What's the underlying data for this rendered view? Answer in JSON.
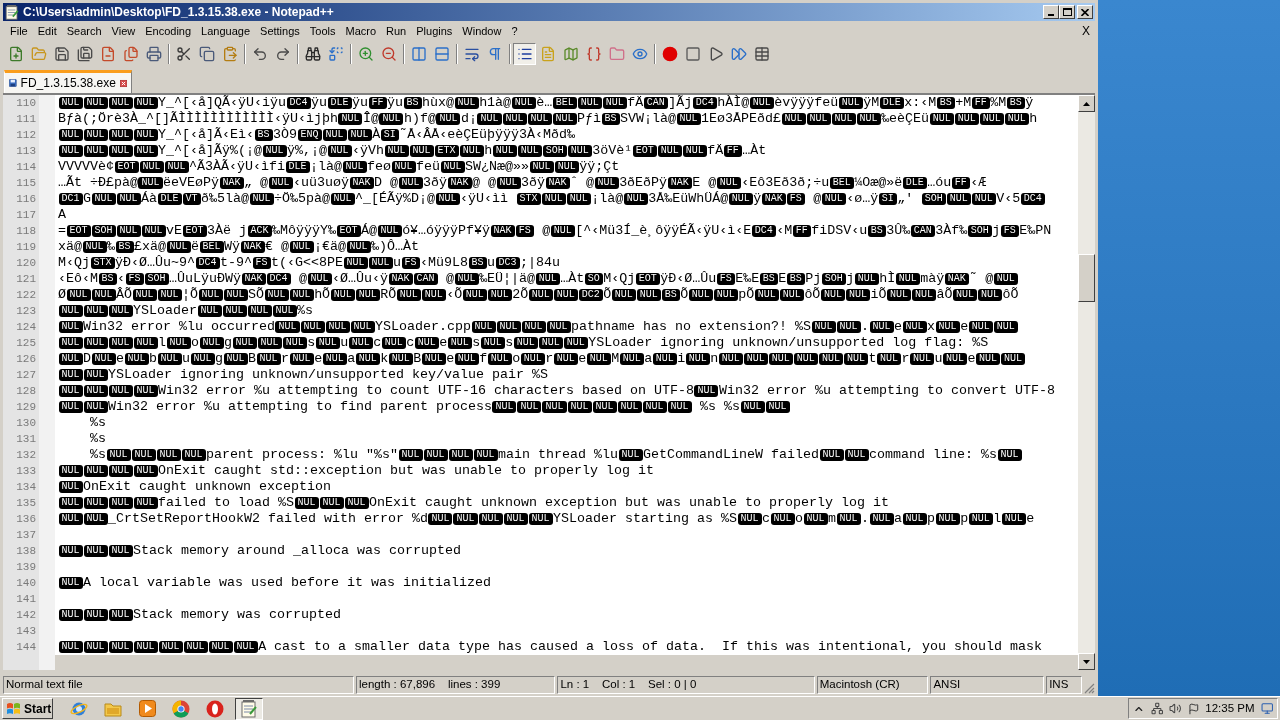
{
  "window": {
    "title": "C:\\Users\\admin\\Desktop\\FD_1.3.15.38.exe - Notepad++"
  },
  "menu": [
    "File",
    "Edit",
    "Search",
    "View",
    "Encoding",
    "Language",
    "Settings",
    "Tools",
    "Macro",
    "Run",
    "Plugins",
    "Window",
    "?"
  ],
  "menu_close": "X",
  "toolbar": [
    [
      {
        "pressed": false
      },
      {
        "pressed": false
      },
      {
        "pressed": false
      },
      {
        "pressed": false
      },
      {
        "pressed": false
      },
      {
        "pressed": false
      },
      {
        "pressed": false
      }
    ],
    [
      {
        "pressed": false
      },
      {
        "pressed": false
      },
      {
        "pressed": false
      }
    ],
    [
      {
        "pressed": false
      },
      {
        "pressed": false
      }
    ],
    [
      {
        "pressed": false
      },
      {
        "pressed": false
      }
    ],
    [
      {
        "pressed": false
      },
      {
        "pressed": false
      }
    ],
    [
      {
        "pressed": false
      },
      {
        "pressed": false
      }
    ],
    [
      {
        "pressed": false
      },
      {
        "pressed": false
      }
    ],
    [
      {
        "pressed": true
      },
      {
        "pressed": false
      },
      {
        "pressed": false
      },
      {
        "pressed": false
      },
      {
        "pressed": false
      },
      {
        "pressed": false
      }
    ],
    [
      {
        "pressed": false
      },
      {
        "pressed": false
      },
      {
        "pressed": false
      },
      {
        "pressed": false
      },
      {
        "pressed": false
      }
    ]
  ],
  "tabs": [
    {
      "label": "FD_1.3.15.38.exe",
      "selected": true
    }
  ],
  "editor": {
    "lines": [
      {
        "number": "110",
        "parts": [
          {
            "ctrl": "NUL"
          },
          {
            "ctrl": "NUL"
          },
          {
            "ctrl": "NUL"
          },
          {
            "ctrl": "NUL"
          },
          "Y_^[‹å]QÃ",
          "‹ÿU‹iÿu",
          {
            "ctrl": "DC4"
          },
          "ÿu",
          {
            "ctrl": "DLE"
          },
          "ÿu",
          {
            "ctrl": "FF"
          },
          "ÿu",
          {
            "ctrl": "BS"
          },
          "hùx@",
          {
            "ctrl": "NUL"
          },
          "h1à@",
          {
            "ctrl": "NUL"
          },
          "è…",
          {
            "ctrl": "BEL"
          },
          {
            "ctrl": "NUL"
          },
          {
            "ctrl": "NUL"
          },
          "fÄ",
          {
            "ctrl": "CAN"
          },
          "]Ãj",
          {
            "ctrl": "DC4"
          },
          "hÀÌ@",
          {
            "ctrl": "NUL"
          },
          "èvÿÿÿfeü",
          {
            "ctrl": "NUL"
          },
          "ÿM",
          {
            "ctrl": "DLE"
          },
          "x:‹M",
          {
            "ctrl": "BS"
          },
          "+M",
          {
            "ctrl": "FF"
          },
          "%M",
          {
            "ctrl": "BS"
          },
          "ÿ"
        ]
      },
      {
        "number": "111",
        "parts": [
          "Bƒà(;Örè3À_^[]ÃÌÌÌÌÌÌÌÌÌÌÌÌ‹ÿU‹ìjþh",
          {
            "ctrl": "NUL"
          },
          "Î@",
          {
            "ctrl": "NUL"
          },
          "h)f@",
          {
            "ctrl": "NUL"
          },
          "d¡",
          {
            "ctrl": "NUL"
          },
          {
            "ctrl": "NUL"
          },
          {
            "ctrl": "NUL"
          },
          {
            "ctrl": "NUL"
          },
          "Pƒì",
          {
            "ctrl": "BS"
          },
          "SVW¡là@",
          {
            "ctrl": "NUL"
          },
          "1Eø3ÅPEðd£",
          {
            "ctrl": "NUL"
          },
          {
            "ctrl": "NUL"
          },
          {
            "ctrl": "NUL"
          },
          {
            "ctrl": "NUL"
          },
          "‰eèÇEü",
          {
            "ctrl": "NUL"
          },
          {
            "ctrl": "NUL"
          },
          {
            "ctrl": "NUL"
          },
          {
            "ctrl": "NUL"
          },
          "h"
        ]
      },
      {
        "number": "112",
        "parts": [
          {
            "ctrl": "NUL"
          },
          {
            "ctrl": "NUL"
          },
          {
            "ctrl": "NUL"
          },
          {
            "ctrl": "NUL"
          },
          "Y_^[‹å]Ã",
          "‹Eì‹",
          {
            "ctrl": "BS"
          },
          "3Ò9",
          {
            "ctrl": "ENQ"
          },
          {
            "ctrl": "NUL"
          },
          {
            "ctrl": "NUL"
          },
          "À",
          {
            "ctrl": "SI"
          },
          "˜Å‹ÂÅ‹eèÇEüþÿÿÿ3À‹Mðd‰"
        ]
      },
      {
        "number": "113",
        "parts": [
          {
            "ctrl": "NUL"
          },
          {
            "ctrl": "NUL"
          },
          {
            "ctrl": "NUL"
          },
          {
            "ctrl": "NUL"
          },
          "Y_^[‹å]Ãÿ%(¡@",
          {
            "ctrl": "NUL"
          },
          "ÿ%,¡@",
          {
            "ctrl": "NUL"
          },
          "‹ÿVh",
          {
            "ctrl": "NUL"
          },
          {
            "ctrl": "NUL"
          },
          {
            "ctrl": "ETX"
          },
          {
            "ctrl": "NUL"
          },
          "h",
          {
            "ctrl": "NUL"
          },
          {
            "ctrl": "NUL"
          },
          {
            "ctrl": "SOH"
          },
          {
            "ctrl": "NUL"
          },
          "3öVè¹",
          {
            "ctrl": "EOT"
          },
          {
            "ctrl": "NUL"
          },
          {
            "ctrl": "NUL"
          },
          "fÄ",
          {
            "ctrl": "FF"
          },
          "…Àt"
        ]
      },
      {
        "number": "114",
        "parts": [
          "VVVVVè¢",
          {
            "ctrl": "EOT"
          },
          {
            "ctrl": "NUL"
          },
          {
            "ctrl": "NUL"
          },
          "^Ã3ÀÃ",
          "‹ÿU‹ìfi",
          {
            "ctrl": "DLE"
          },
          "¡là@",
          {
            "ctrl": "NUL"
          },
          "feø",
          {
            "ctrl": "NUL"
          },
          "feü",
          {
            "ctrl": "NUL"
          },
          "SW¿Næ@»»",
          {
            "ctrl": "NUL"
          },
          {
            "ctrl": "NUL"
          },
          "ÿÿ;Çt"
        ]
      },
      {
        "number": "115",
        "parts": [
          "…Ãt ÷Ð£pà@",
          {
            "ctrl": "NUL"
          },
          "ëeVEøPÿ",
          {
            "ctrl": "NAK"
          },
          "„ @",
          {
            "ctrl": "NUL"
          },
          "‹uü3uøÿ",
          {
            "ctrl": "NAK"
          },
          "D @",
          {
            "ctrl": "NUL"
          },
          "3ðÿ",
          {
            "ctrl": "NAK"
          },
          "@ @",
          {
            "ctrl": "NUL"
          },
          "3ðÿ",
          {
            "ctrl": "NAK"
          },
          "ˆ @",
          {
            "ctrl": "NUL"
          },
          "3ðEðPÿ",
          {
            "ctrl": "NAK"
          },
          "E @",
          {
            "ctrl": "NUL"
          },
          "‹Eô3Eð3ð;÷u",
          {
            "ctrl": "BEL"
          },
          "¼Oæ@»ë",
          {
            "ctrl": "DLE"
          },
          "…óu",
          {
            "ctrl": "FF"
          },
          "‹Æ"
        ]
      },
      {
        "number": "116",
        "parts": [
          {
            "ctrl": "DC1"
          },
          "G",
          {
            "ctrl": "NUL"
          },
          {
            "ctrl": "NUL"
          },
          "Áà",
          {
            "ctrl": "DLE"
          },
          {
            "ctrl": "VT"
          },
          "ð‰5là@",
          {
            "ctrl": "NUL"
          },
          "÷Ö‰5pà@",
          {
            "ctrl": "NUL"
          },
          "^_[ÉÃÿ%D¡@",
          {
            "ctrl": "NUL"
          },
          "‹ÿU‹ìì ",
          {
            "ctrl": "STX"
          },
          {
            "ctrl": "NUL"
          },
          {
            "ctrl": "NUL"
          },
          "¡là@",
          {
            "ctrl": "NUL"
          },
          "3Å‰EüWhÜÁ@",
          {
            "ctrl": "NUL"
          },
          "ÿ",
          {
            "ctrl": "NAK"
          },
          {
            "ctrl": "FS"
          },
          " @",
          {
            "ctrl": "NUL"
          },
          "‹ø…ÿ",
          {
            "ctrl": "SI"
          },
          "„' ",
          {
            "ctrl": "SOH"
          },
          {
            "ctrl": "NUL"
          },
          {
            "ctrl": "NUL"
          },
          "V‹5",
          {
            "ctrl": "DC4"
          }
        ]
      },
      {
        "number": "117",
        "parts": [
          "A"
        ]
      },
      {
        "number": "118",
        "parts": [
          "=",
          {
            "ctrl": "EOT"
          },
          {
            "ctrl": "SOH"
          },
          {
            "ctrl": "NUL"
          },
          {
            "ctrl": "NUL"
          },
          "vE",
          {
            "ctrl": "EOT"
          },
          "3Àë j",
          {
            "ctrl": "ACK"
          },
          "‰MôÿÿÿY‰",
          {
            "ctrl": "EOT"
          },
          "Á@",
          {
            "ctrl": "NUL"
          },
          "ó¥…óÿÿÿPf¥ÿ",
          {
            "ctrl": "NAK"
          },
          {
            "ctrl": "FS"
          },
          " @",
          {
            "ctrl": "NUL"
          },
          "[^‹Mü3Í_è¸ôÿÿÉÃ",
          "‹ÿU‹ì‹E",
          {
            "ctrl": "DC4"
          },
          "‹M",
          {
            "ctrl": "FF"
          },
          "fiDSV‹u",
          {
            "ctrl": "BS"
          },
          "3Û‰",
          {
            "ctrl": "CAN"
          },
          "3Àf‰",
          {
            "ctrl": "SOH"
          },
          "j",
          {
            "ctrl": "FS"
          },
          "E‰PN"
        ]
      },
      {
        "number": "119",
        "parts": [
          "xä@",
          {
            "ctrl": "NUL"
          },
          "‰",
          {
            "ctrl": "BS"
          },
          "£xä@",
          {
            "ctrl": "NUL"
          },
          "ë",
          {
            "ctrl": "BEL"
          },
          "Wÿ",
          {
            "ctrl": "NAK"
          },
          "€ @",
          {
            "ctrl": "NUL"
          },
          "¡€ä@",
          {
            "ctrl": "NUL"
          },
          "‰)Ô…Àt"
        ]
      },
      {
        "number": "120",
        "parts": [
          "M‹Qj",
          {
            "ctrl": "STX"
          },
          "ÿÐ‹Ø…Ûu~9^",
          {
            "ctrl": "DC4"
          },
          "t-9^",
          {
            "ctrl": "FS"
          },
          "t(‹G<<8PE",
          {
            "ctrl": "NUL"
          },
          {
            "ctrl": "NUL"
          },
          "u",
          {
            "ctrl": "FS"
          },
          "‹Mü9L8",
          {
            "ctrl": "BS"
          },
          "u",
          {
            "ctrl": "DC3"
          },
          ";|84u"
        ]
      },
      {
        "number": "121",
        "parts": [
          "‹Eô‹M",
          {
            "ctrl": "BS"
          },
          "‹",
          {
            "ctrl": "FS"
          },
          {
            "ctrl": "SOH"
          },
          "…ÛuLÿuÐWÿ",
          {
            "ctrl": "NAK"
          },
          {
            "ctrl": "DC4"
          },
          " @",
          {
            "ctrl": "NUL"
          },
          "‹Ø…Ûu‹ÿ",
          {
            "ctrl": "NAK"
          },
          {
            "ctrl": "CAN"
          },
          " @",
          {
            "ctrl": "NUL"
          },
          "‰EÜ¦|ä@",
          {
            "ctrl": "NUL"
          },
          "…Àt",
          {
            "ctrl": "SO"
          },
          "M‹Qj",
          {
            "ctrl": "EOT"
          },
          "ÿÐ‹Ø…Ûu",
          {
            "ctrl": "FS"
          },
          "E‰E",
          {
            "ctrl": "BS"
          },
          "E",
          {
            "ctrl": "BS"
          },
          "Pj",
          {
            "ctrl": "SOH"
          },
          "j",
          {
            "ctrl": "NUL"
          },
          "hÌ",
          {
            "ctrl": "NUL"
          },
          "màÿ",
          {
            "ctrl": "NAK"
          },
          "˜ @",
          {
            "ctrl": "NUL"
          }
        ]
      },
      {
        "number": "122",
        "parts": [
          "Ø",
          {
            "ctrl": "NUL"
          },
          {
            "ctrl": "NUL"
          },
          "ÂÕ",
          {
            "ctrl": "NUL"
          },
          {
            "ctrl": "NUL"
          },
          "¦Õ",
          {
            "ctrl": "NUL"
          },
          {
            "ctrl": "NUL"
          },
          "SÕ",
          {
            "ctrl": "NUL"
          },
          {
            "ctrl": "NUL"
          },
          "hÕ",
          {
            "ctrl": "NUL"
          },
          {
            "ctrl": "NUL"
          },
          "RÕ",
          {
            "ctrl": "NUL"
          },
          {
            "ctrl": "NUL"
          },
          "‹Õ",
          {
            "ctrl": "NUL"
          },
          {
            "ctrl": "NUL"
          },
          "2Õ",
          {
            "ctrl": "NUL"
          },
          {
            "ctrl": "NUL"
          },
          {
            "ctrl": "DC2"
          },
          "Õ",
          {
            "ctrl": "NUL"
          },
          {
            "ctrl": "NUL"
          },
          {
            "ctrl": "BS"
          },
          "Õ",
          {
            "ctrl": "NUL"
          },
          {
            "ctrl": "NUL"
          },
          "pÕ",
          {
            "ctrl": "NUL"
          },
          {
            "ctrl": "NUL"
          },
          "ôÕ",
          {
            "ctrl": "NUL"
          },
          {
            "ctrl": "NUL"
          },
          "iÕ",
          {
            "ctrl": "NUL"
          },
          {
            "ctrl": "NUL"
          },
          "âÕ",
          {
            "ctrl": "NUL"
          },
          {
            "ctrl": "NUL"
          },
          "ôÕ"
        ]
      },
      {
        "number": "123",
        "parts": [
          {
            "ctrl": "NUL"
          },
          {
            "ctrl": "NUL"
          },
          {
            "ctrl": "NUL"
          },
          "YSLoader",
          {
            "ctrl": "NUL"
          },
          {
            "ctrl": "NUL"
          },
          {
            "ctrl": "NUL"
          },
          {
            "ctrl": "NUL"
          },
          "%s"
        ]
      },
      {
        "number": "124",
        "parts": [
          {
            "ctrl": "NUL"
          },
          "Win32 error %lu occurred",
          {
            "ctrl": "NUL"
          },
          {
            "ctrl": "NUL"
          },
          {
            "ctrl": "NUL"
          },
          {
            "ctrl": "NUL"
          },
          "YSLoader.cpp",
          {
            "ctrl": "NUL"
          },
          {
            "ctrl": "NUL"
          },
          {
            "ctrl": "NUL"
          },
          {
            "ctrl": "NUL"
          },
          "pathname has no extension?! %S",
          {
            "ctrl": "NUL"
          },
          {
            "ctrl": "NUL"
          },
          ".",
          {
            "ctrl": "NUL"
          },
          "e",
          {
            "ctrl": "NUL"
          },
          "x",
          {
            "ctrl": "NUL"
          },
          "e",
          {
            "ctrl": "NUL"
          },
          {
            "ctrl": "NUL"
          }
        ]
      },
      {
        "number": "125",
        "parts": [
          {
            "ctrl": "NUL"
          },
          {
            "ctrl": "NUL"
          },
          {
            "ctrl": "NUL"
          },
          {
            "ctrl": "NUL"
          },
          "l",
          {
            "ctrl": "NUL"
          },
          "o",
          {
            "ctrl": "NUL"
          },
          "g",
          {
            "ctrl": "NUL"
          },
          {
            "ctrl": "NUL"
          },
          {
            "ctrl": "NUL"
          },
          "s",
          {
            "ctrl": "NUL"
          },
          "u",
          {
            "ctrl": "NUL"
          },
          "c",
          {
            "ctrl": "NUL"
          },
          "c",
          {
            "ctrl": "NUL"
          },
          "e",
          {
            "ctrl": "NUL"
          },
          "s",
          {
            "ctrl": "NUL"
          },
          "s",
          {
            "ctrl": "NUL"
          },
          {
            "ctrl": "NUL"
          },
          {
            "ctrl": "NUL"
          },
          "YSLoader ignoring unknown/unsupported log flag: %S"
        ]
      },
      {
        "number": "126",
        "parts": [
          {
            "ctrl": "NUL"
          },
          "D",
          {
            "ctrl": "NUL"
          },
          "e",
          {
            "ctrl": "NUL"
          },
          "b",
          {
            "ctrl": "NUL"
          },
          "u",
          {
            "ctrl": "NUL"
          },
          "g",
          {
            "ctrl": "NUL"
          },
          "B",
          {
            "ctrl": "NUL"
          },
          "r",
          {
            "ctrl": "NUL"
          },
          "e",
          {
            "ctrl": "NUL"
          },
          "a",
          {
            "ctrl": "NUL"
          },
          "k",
          {
            "ctrl": "NUL"
          },
          "B",
          {
            "ctrl": "NUL"
          },
          "e",
          {
            "ctrl": "NUL"
          },
          "f",
          {
            "ctrl": "NUL"
          },
          "o",
          {
            "ctrl": "NUL"
          },
          "r",
          {
            "ctrl": "NUL"
          },
          "e",
          {
            "ctrl": "NUL"
          },
          "M",
          {
            "ctrl": "NUL"
          },
          "a",
          {
            "ctrl": "NUL"
          },
          "i",
          {
            "ctrl": "NUL"
          },
          "n",
          {
            "ctrl": "NUL"
          },
          {
            "ctrl": "NUL"
          },
          {
            "ctrl": "NUL"
          },
          {
            "ctrl": "NUL"
          },
          {
            "ctrl": "NUL"
          },
          {
            "ctrl": "NUL"
          },
          "t",
          {
            "ctrl": "NUL"
          },
          "r",
          {
            "ctrl": "NUL"
          },
          "u",
          {
            "ctrl": "NUL"
          },
          "e",
          {
            "ctrl": "NUL"
          },
          {
            "ctrl": "NUL"
          }
        ]
      },
      {
        "number": "127",
        "parts": [
          {
            "ctrl": "NUL"
          },
          {
            "ctrl": "NUL"
          },
          "YSLoader ignoring unknown/unsupported key/value pair %S"
        ]
      },
      {
        "number": "128",
        "parts": [
          {
            "ctrl": "NUL"
          },
          {
            "ctrl": "NUL"
          },
          {
            "ctrl": "NUL"
          },
          {
            "ctrl": "NUL"
          },
          "Win32 error %u attempting to count UTF-16 characters based on UTF-8",
          {
            "ctrl": "NUL"
          },
          "Win32 error %u attempting to convert UTF-8"
        ]
      },
      {
        "number": "129",
        "parts": [
          {
            "ctrl": "NUL"
          },
          {
            "ctrl": "NUL"
          },
          "Win32 error %u attempting to find parent process",
          {
            "ctrl": "NUL"
          },
          {
            "ctrl": "NUL"
          },
          {
            "ctrl": "NUL"
          },
          {
            "ctrl": "NUL"
          },
          {
            "ctrl": "NUL"
          },
          {
            "ctrl": "NUL"
          },
          {
            "ctrl": "NUL"
          },
          {
            "ctrl": "NUL"
          },
          " %s %s",
          {
            "ctrl": "NUL"
          },
          {
            "ctrl": "NUL"
          }
        ]
      },
      {
        "number": "130",
        "parts": [
          "    %s"
        ]
      },
      {
        "number": "131",
        "parts": [
          "    %s"
        ]
      },
      {
        "number": "132",
        "parts": [
          "    %s",
          {
            "ctrl": "NUL"
          },
          {
            "ctrl": "NUL"
          },
          {
            "ctrl": "NUL"
          },
          {
            "ctrl": "NUL"
          },
          "parent process: %lu \"%s\"",
          {
            "ctrl": "NUL"
          },
          {
            "ctrl": "NUL"
          },
          {
            "ctrl": "NUL"
          },
          {
            "ctrl": "NUL"
          },
          "main thread %lu",
          {
            "ctrl": "NUL"
          },
          "GetCommandLineW failed",
          {
            "ctrl": "NUL"
          },
          {
            "ctrl": "NUL"
          },
          "command line: %s",
          {
            "ctrl": "NUL"
          }
        ]
      },
      {
        "number": "133",
        "parts": [
          {
            "ctrl": "NUL"
          },
          {
            "ctrl": "NUL"
          },
          {
            "ctrl": "NUL"
          },
          {
            "ctrl": "NUL"
          },
          "OnExit caught std::exception but was unable to properly log it"
        ]
      },
      {
        "number": "134",
        "parts": [
          {
            "ctrl": "NUL"
          },
          "OnExit caught unknown exception"
        ]
      },
      {
        "number": "135",
        "parts": [
          {
            "ctrl": "NUL"
          },
          {
            "ctrl": "NUL"
          },
          {
            "ctrl": "NUL"
          },
          {
            "ctrl": "NUL"
          },
          "failed to load %S",
          {
            "ctrl": "NUL"
          },
          {
            "ctrl": "NUL"
          },
          {
            "ctrl": "NUL"
          },
          "OnExit caught unknown exception but was unable to properly log it"
        ]
      },
      {
        "number": "136",
        "parts": [
          {
            "ctrl": "NUL"
          },
          {
            "ctrl": "NUL"
          },
          "_CrtSetReportHookW2 failed with error %d",
          {
            "ctrl": "NUL"
          },
          {
            "ctrl": "NUL"
          },
          {
            "ctrl": "NUL"
          },
          {
            "ctrl": "NUL"
          },
          {
            "ctrl": "NUL"
          },
          "YSLoader starting as %S",
          {
            "ctrl": "NUL"
          },
          "c",
          {
            "ctrl": "NUL"
          },
          "o",
          {
            "ctrl": "NUL"
          },
          "m",
          {
            "ctrl": "NUL"
          },
          ".",
          {
            "ctrl": "NUL"
          },
          "a",
          {
            "ctrl": "NUL"
          },
          "p",
          {
            "ctrl": "NUL"
          },
          "p",
          {
            "ctrl": "NUL"
          },
          "l",
          {
            "ctrl": "NUL"
          },
          "e"
        ]
      },
      {
        "number": "137"
      },
      {
        "number": "138",
        "parts": [
          {
            "ctrl": "NUL"
          },
          {
            "ctrl": "NUL"
          },
          {
            "ctrl": "NUL"
          },
          "Stack memory around _alloca was corrupted"
        ]
      },
      {
        "number": "139"
      },
      {
        "number": "140",
        "parts": [
          {
            "ctrl": "NUL"
          },
          "A local variable was used before it was initialized"
        ]
      },
      {
        "number": "141"
      },
      {
        "number": "142",
        "parts": [
          {
            "ctrl": "NUL"
          },
          {
            "ctrl": "NUL"
          },
          {
            "ctrl": "NUL"
          },
          "Stack memory was corrupted"
        ]
      },
      {
        "number": "143"
      },
      {
        "number": "144",
        "parts": [
          {
            "ctrl": "NUL"
          },
          {
            "ctrl": "NUL"
          },
          {
            "ctrl": "NUL"
          },
          {
            "ctrl": "NUL"
          },
          {
            "ctrl": "NUL"
          },
          {
            "ctrl": "NUL"
          },
          {
            "ctrl": "NUL"
          },
          {
            "ctrl": "NUL"
          },
          "A cast to a smaller data type has caused a loss of data.  If this was intentional, you should mask"
        ]
      }
    ]
  },
  "status_bar": [
    "Normal text file",
    "length : 67,896    lines : 399",
    "Ln : 1    Col : 1    Sel : 0 | 0",
    "Macintosh (CR)",
    "ANSI",
    "INS"
  ],
  "taskbar": {
    "start": "Start",
    "apps": [
      {
        "selected": false
      },
      {
        "selected": false
      },
      {
        "selected": false
      },
      {
        "selected": false
      },
      {
        "selected": false
      },
      {
        "selected": true
      }
    ],
    "clock": "12:35 PM"
  }
}
